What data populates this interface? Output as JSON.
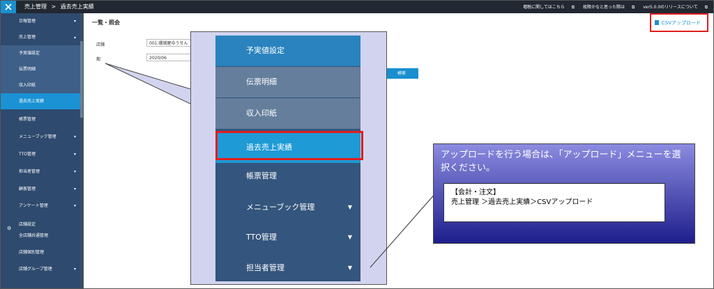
{
  "topbar": {
    "breadcrumb": [
      "売上管理",
      ">",
      "過去売上実績"
    ],
    "links": [
      "増税に関してはこちら",
      "故障かなと思った際は",
      "ver5.0.0のリリースについて"
    ]
  },
  "sidebar": {
    "items": [
      {
        "label": "日報管理"
      },
      {
        "label": "売上管理"
      },
      {
        "label": "予実値設定"
      },
      {
        "label": "伝票明細"
      },
      {
        "label": "収入印紙"
      },
      {
        "label": "過去売上実績"
      },
      {
        "label": "帳票管理"
      },
      {
        "label": "メニューブック管理"
      },
      {
        "label": "TTO管理"
      },
      {
        "label": "担当者管理"
      },
      {
        "label": "顧客管理"
      },
      {
        "label": "アンケート管理"
      },
      {
        "label": "店舗設定"
      },
      {
        "label": "全店舗共通管理"
      },
      {
        "label": "店舗個別管理"
      },
      {
        "label": "店舗グループ管理"
      }
    ]
  },
  "main": {
    "title": "一覧・照会",
    "csv_button": "CSVアップロード",
    "store_label": "店舗",
    "store_value": "001:珊瑚屋ゆうせん",
    "period_value": "2020/06",
    "search_button": "検索"
  },
  "zoom_menu": {
    "items": [
      "予実値設定",
      "伝票明細",
      "収入印紙",
      "過去売上実績",
      "帳票管理",
      "メニューブック管理",
      "TTO管理",
      "担当者管理"
    ]
  },
  "note": {
    "text": "アップロードを行う場合は、「アップロード」メニューを選択ください。",
    "path_line1": "【会計・注文】",
    "path_line2": "売上管理 ＞過去売上実績＞CSVアップロード"
  },
  "colors": {
    "sidebar": "#2e4a6e",
    "active": "#1a92d4",
    "highlight": "#e21d1d",
    "accent": "#1a8fcf"
  }
}
